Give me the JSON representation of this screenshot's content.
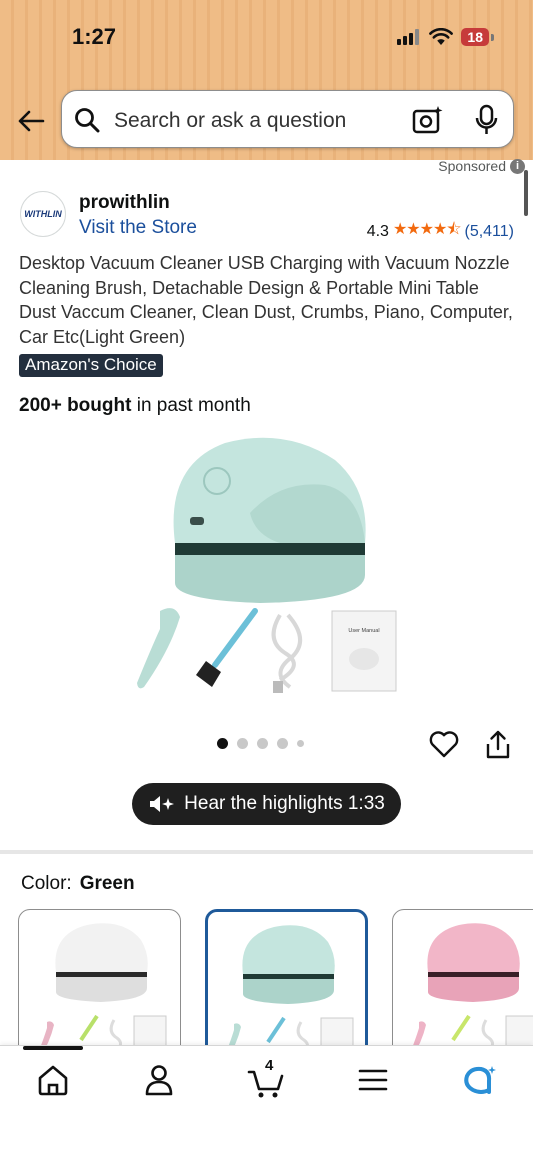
{
  "status_bar": {
    "time": "1:27",
    "battery": "18"
  },
  "search": {
    "placeholder": "Search or ask a question"
  },
  "sponsored": {
    "label": "Sponsored",
    "info": "i"
  },
  "seller": {
    "logo_text": "WITHLIN",
    "name": "prowithlin",
    "store_link": "Visit the Store",
    "rating": "4.3",
    "stars": "★★★★⯪",
    "review_count": "(5,411)"
  },
  "product": {
    "title": "Desktop Vacuum Cleaner USB Charging with Vacuum Nozzle Cleaning Brush, Detachable Design & Portable Mini Table Dust Vaccum Cleaner, Clean Dust, Crumbs, Piano, Computer, Car Etc(Light Green)",
    "badge": "Amazon's Choice",
    "bought_bold": "200+ bought",
    "bought_rest": " in past month",
    "manual_label": "User Manual"
  },
  "carousel": {
    "total_images": 5,
    "active_index": 0
  },
  "highlights": {
    "label": "Hear the highlights 1:33"
  },
  "color": {
    "label": "Color:",
    "selected": "Green",
    "options": [
      {
        "name": "White",
        "hex": "#f2f2f2",
        "selected": false
      },
      {
        "name": "Green",
        "hex": "#bfe3dc",
        "selected": true
      },
      {
        "name": "Pink",
        "hex": "#f2b6c8",
        "selected": false
      }
    ]
  },
  "bottom_nav": {
    "items": [
      "home-icon",
      "account-icon",
      "cart-icon",
      "menu-icon",
      "rufus-icon"
    ],
    "cart_count": "4"
  },
  "colors": {
    "accent_link": "#1b4f9c",
    "star": "#f26a0f",
    "badge_bg": "#232f3e",
    "selected_border": "#1f5a9a"
  }
}
